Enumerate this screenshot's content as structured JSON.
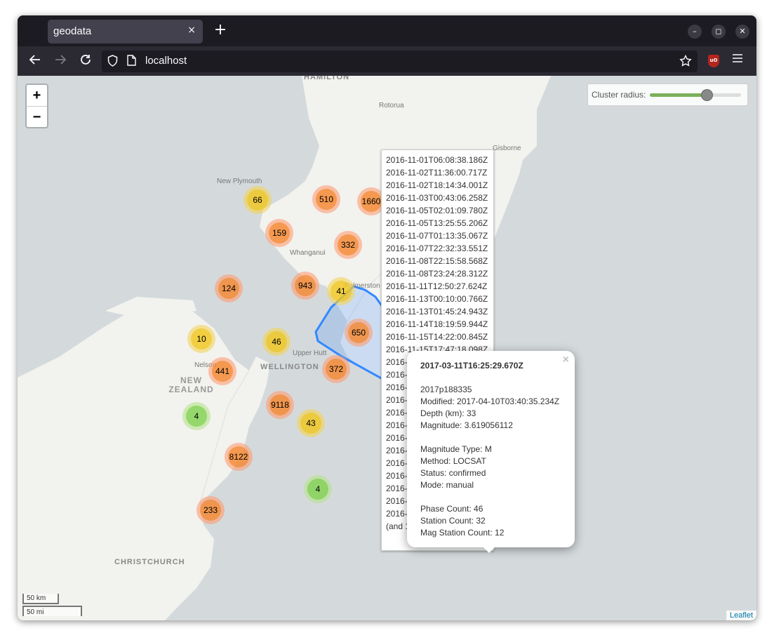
{
  "browser": {
    "tab_title": "geodata",
    "tab_close": "×",
    "new_tab": "+",
    "url": "localhost",
    "ublock_label": "uO",
    "window_minimize": "–",
    "window_maximize": "◻",
    "window_close": "✕"
  },
  "map": {
    "zoom_in": "+",
    "zoom_out": "−",
    "cluster_radius_label": "Cluster radius:",
    "cluster_radius_fraction": 0.62,
    "places": {
      "hamilton": "HAMILTON",
      "rotorua": "Rotorua",
      "gisborne": "Gisborne",
      "new_plymouth": "New Plymouth",
      "whanganui": "Whanganui",
      "palmerston_north": "Palmerston North",
      "nelson": "Nelson",
      "upper_hutt": "Upper Hutt",
      "wellington": "WELLINGTON",
      "new_zealand": "NEW ZEALAND",
      "christchurch": "CHRISTCHURCH"
    },
    "clusters": [
      {
        "count": "66",
        "size": "medium"
      },
      {
        "count": "510",
        "size": "large"
      },
      {
        "count": "1660",
        "size": "large"
      },
      {
        "count": "159",
        "size": "large"
      },
      {
        "count": "332",
        "size": "large"
      },
      {
        "count": "124",
        "size": "large"
      },
      {
        "count": "943",
        "size": "large"
      },
      {
        "count": "41",
        "size": "medium"
      },
      {
        "count": "10",
        "size": "medium"
      },
      {
        "count": "46",
        "size": "medium"
      },
      {
        "count": "650",
        "size": "large"
      },
      {
        "count": "441",
        "size": "large"
      },
      {
        "count": "372",
        "size": "large"
      },
      {
        "count": "9118",
        "size": "large"
      },
      {
        "count": "4",
        "size": "small"
      },
      {
        "count": "43",
        "size": "medium"
      },
      {
        "count": "8122",
        "size": "large"
      },
      {
        "count": "4",
        "size": "small"
      },
      {
        "count": "233",
        "size": "large"
      }
    ],
    "scale": {
      "km": "50 km",
      "mi": "50 mi"
    },
    "attribution": "Leaflet"
  },
  "tooltip_list": {
    "items": [
      "2016-11-01T06:08:38.186Z",
      "2016-11-02T11:36:00.717Z",
      "2016-11-02T18:14:34.001Z",
      "2016-11-03T00:43:06.258Z",
      "2016-11-05T02:01:09.780Z",
      "2016-11-05T13:25:55.206Z",
      "2016-11-07T01:13:35.067Z",
      "2016-11-07T22:32:33.551Z",
      "2016-11-08T22:15:58.568Z",
      "2016-11-08T23:24:28.312Z",
      "2016-11-11T12:50:27.624Z",
      "2016-11-13T00:10:00.766Z",
      "2016-11-13T01:45:24.943Z",
      "2016-11-14T18:19:59.944Z",
      "2016-11-15T14:22:00.845Z",
      "2016-11-15T17:47:18.098Z",
      "2016-",
      "2016-",
      "2016-",
      "2016-",
      "2016-",
      "2016-",
      "2016-",
      "2016-",
      "2016-",
      "2016-",
      "2016-",
      "2016-",
      "2016-",
      "(and 1"
    ]
  },
  "popup": {
    "close": "×",
    "title": "2017-03-11T16:25:29.670Z",
    "public_id": "2017p188335",
    "modified": "Modified: 2017-04-10T03:40:35.234Z",
    "depth": "Depth (km): 33",
    "magnitude": "Magnitude: 3.619056112",
    "magnitude_type": "Magnitude Type: M",
    "method": "Method: LOCSAT",
    "status": "Status: confirmed",
    "mode": "Mode: manual",
    "phase_count": "Phase Count: 46",
    "station_count": "Station Count: 32",
    "mag_station_count": "Mag Station Count: 12"
  }
}
